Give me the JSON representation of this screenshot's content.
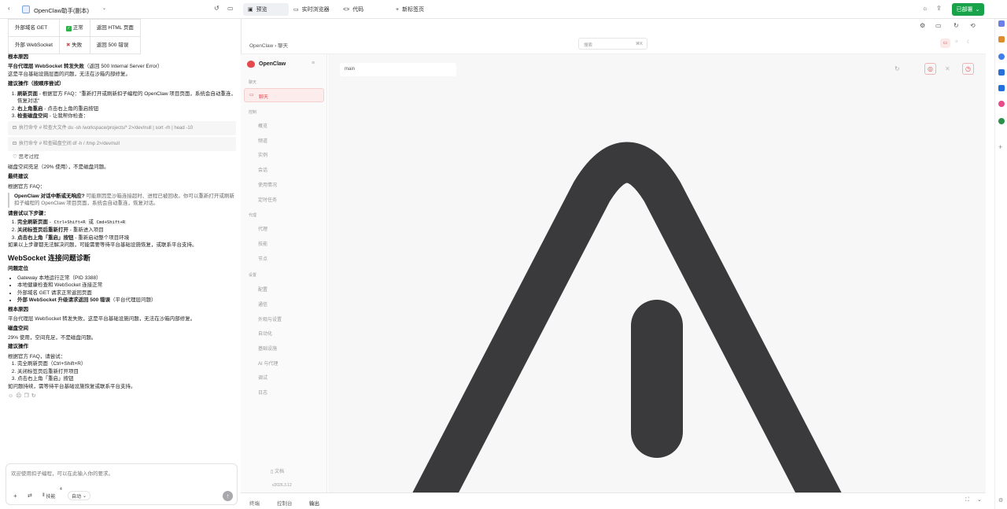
{
  "topbar": {
    "title": "OpenClaw助手(副本)",
    "tabs": [
      "预览",
      "实时浏览器",
      "代码"
    ],
    "new_tab": "新标签页",
    "deploy": "已部署"
  },
  "chat": {
    "table": [
      [
        "外部域名 GET",
        "正常",
        "返回 HTML 页面"
      ],
      [
        "外部 WebSocket",
        "失败",
        "返回 500 错误"
      ]
    ],
    "root_cause_title": "根本原因",
    "root_cause_bold": "平台代理层 WebSocket 转发失败",
    "root_cause_rest": "（返回 500 Internal Server Error）",
    "root_cause_line2": "这是平台基础设施层面的问题，无法在沙箱内部修复。",
    "suggest_title": "建议操作（按顺序尝试）",
    "suggest_items": [
      {
        "b": "刷新页面",
        "t": " - 根据官方 FAQ：\"重新打开或刷新扣子编程的 OpenClaw 项目页面，系统会自动重连，恢复对话\""
      },
      {
        "b": "右上角重启",
        "t": " - 点击右上角的重启按钮"
      },
      {
        "b": "检查磁盘空间",
        "t": " - 让我帮你检查："
      }
    ],
    "cmd1": "执行命令 # 检查大文件 du -sh /workspace/projects/* 2>/dev/null | sort -rh | head -10",
    "cmd2": "执行命令 # 检查磁盘空间 df -h / /tmp 2>/dev/null",
    "thinking": "思考过程",
    "disk_line": "磁盘空间充足（29% 使用），不是磁盘问题。",
    "final_title": "最终建议",
    "faq_intro": "根据官方 FAQ：",
    "faq_q": "OpenClaw 对话中断或无响应?",
    "faq_a": " 可能原因是沙箱连接超时、进程已被回收。你可以重新打开或刷新扣子编程的 OpenClaw 项目页面，系统会自动重连，恢复对话。",
    "steps_title": "请尝试以下步骤：",
    "steps": [
      {
        "b": "完全刷新页面",
        "t": " - ",
        "c1": "Ctrl+Shift+R",
        "m": " 或 ",
        "c2": "Cmd+Shift+R"
      },
      {
        "b": "关闭标签页后重新打开",
        "t": " - 重新进入项目"
      },
      {
        "b": "点击右上角「重启」按钮",
        "t": " - 重新启动整个项目环境"
      }
    ],
    "steps_tail": "如果以上步骤都无法解决问题，可能需要等待平台基础设施恢复，或联系平台支持。",
    "ws_heading": "WebSocket 连接问题诊断",
    "locate_title": "问题定位",
    "locate_items": [
      "Gateway 本地运行正常（PID 3388）",
      "本地健康检查和 WebSocket 连接正常",
      "外部域名 GET 请求正常返回页面"
    ],
    "locate_bold": "外部 WebSocket 升级请求返回 500 错误",
    "locate_bold_tail": "（平台代理层问题）",
    "rc2_title": "根本原因",
    "rc2_text": "平台代理层 WebSocket 转发失败，这是平台基础设施问题，无法在沙箱内部修复。",
    "disk_title": "磁盘空间",
    "disk_text": "29% 使用，空间充足，不是磁盘问题。",
    "action_title": "建议操作",
    "action_intro": "根据官方 FAQ，请尝试：",
    "action_items": [
      "完全刷新页面（Ctrl+Shift+R）",
      "关闭标签页后重新打开项目",
      "点击右上角「重启」按钮"
    ],
    "action_tail": "如问题持续，需等待平台基础设施恢复或联系平台支持。"
  },
  "input": {
    "placeholder": "欢迎使用扣子编程，可以在此输入你的要求。",
    "skill_label": "技能",
    "skill_count": "4",
    "mode": "自动"
  },
  "preview": {
    "breadcrumb": "OpenClaw › 聊天",
    "search_placeholder": "搜索",
    "search_shortcut": "⌘K",
    "brand": "OpenClaw",
    "main_field": "main",
    "sections": [
      {
        "label": "聊天",
        "items": [
          "聊天"
        ]
      },
      {
        "label": "控制",
        "items": [
          "概览",
          "频道",
          "实例",
          "会话",
          "使用情况",
          "定时任务"
        ]
      },
      {
        "label": "代理",
        "items": [
          "代理",
          "技能",
          "节点"
        ]
      },
      {
        "label": "设置",
        "items": [
          "配置",
          "通信",
          "外观与设置",
          "自动化",
          "基础设施",
          "AI 与代理",
          "调试",
          "日志"
        ]
      }
    ],
    "docs": "文档",
    "version": "v2026.3.12"
  },
  "bottom": {
    "tabs": [
      "终端",
      "控制台",
      "输出"
    ]
  },
  "colors": {
    "deploy_green": "#18a34a",
    "accent_red": "#e5484d",
    "logo_dark": "#3a3a3c"
  }
}
